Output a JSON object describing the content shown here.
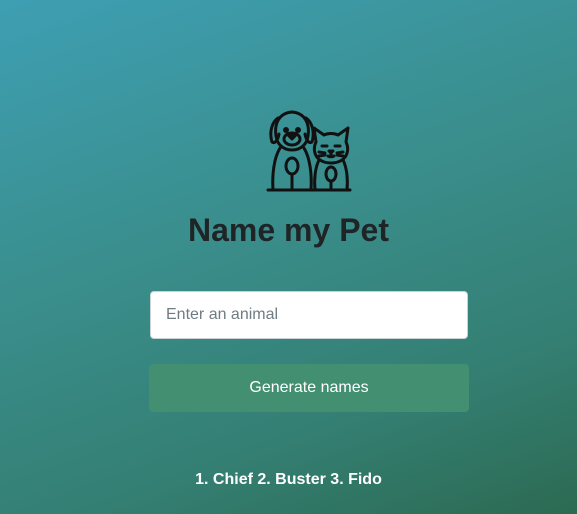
{
  "app": {
    "title": "Name my Pet",
    "logo_icon": "dog-and-cat-icon"
  },
  "form": {
    "animal_input_value": "",
    "animal_input_placeholder": "Enter an animal",
    "submit_label": "Generate names"
  },
  "result": {
    "text": "1. Chief 2. Buster 3. Fido"
  },
  "colors": {
    "background_start": "#3e9fb3",
    "background_end": "#2c6a52",
    "button": "#438f72",
    "title_text": "#1f2426"
  }
}
